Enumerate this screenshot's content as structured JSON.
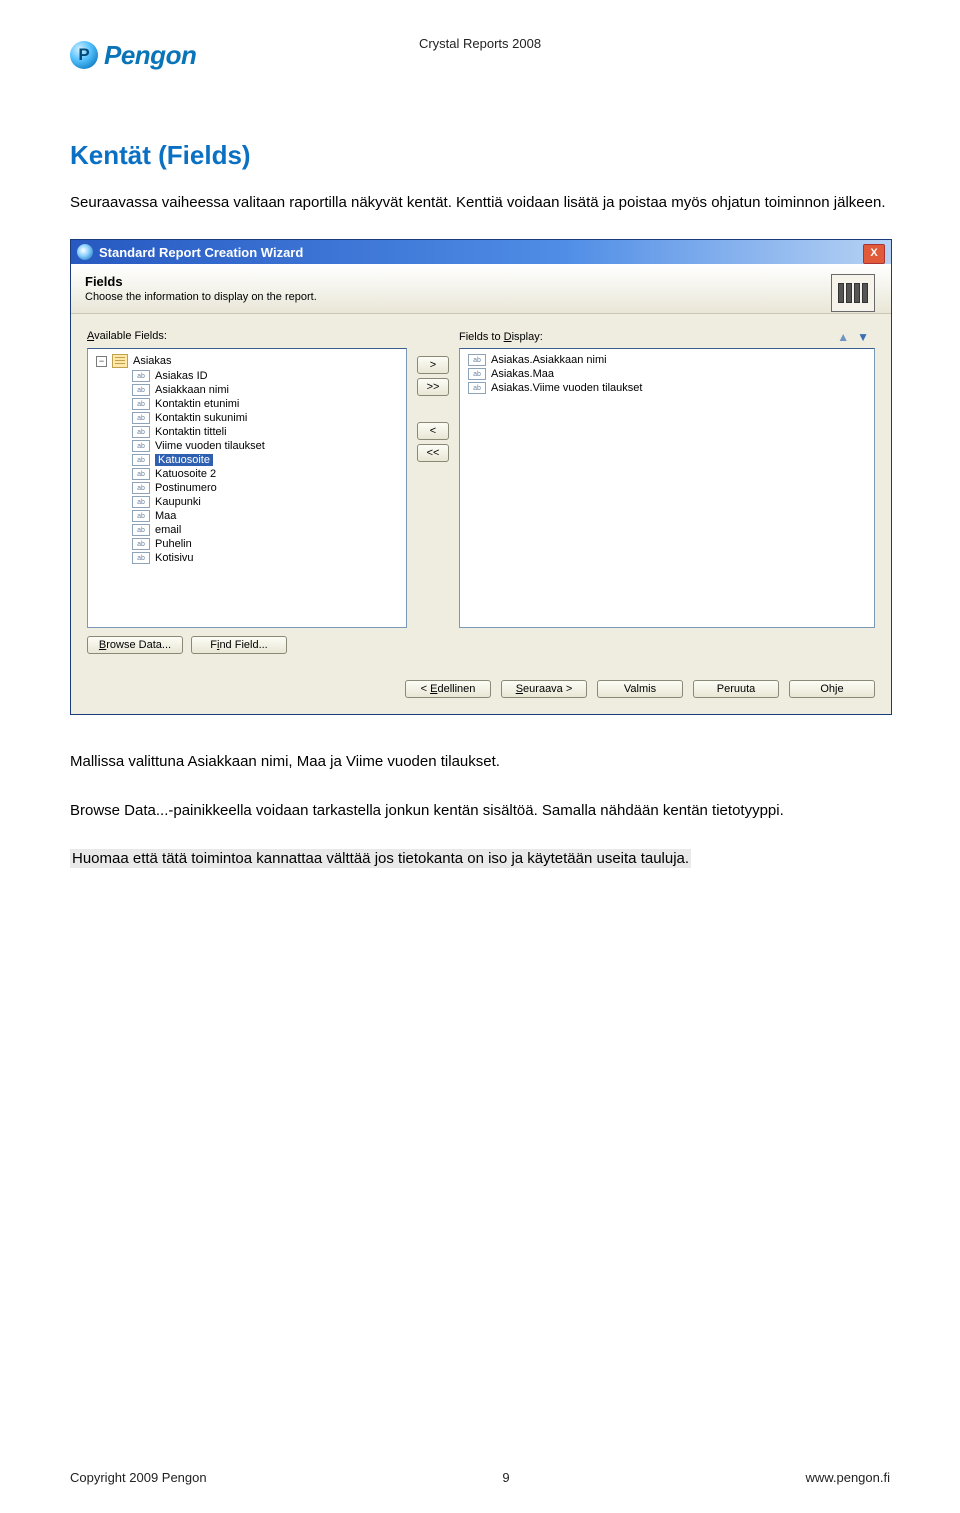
{
  "header": {
    "logo_letter": "P",
    "logo_text": "Pengon",
    "doc_title": "Crystal Reports 2008"
  },
  "section": {
    "title": "Kentät (Fields)",
    "p1": "Seuraavassa vaiheessa valitaan raportilla näkyvät kentät. Kenttiä voidaan lisätä ja poistaa myös ohjatun toiminnon jälkeen.",
    "p2_a": "Mallissa valittuna Asiakkaan nimi, Maa ja Viime vuoden tilaukset.",
    "p3_a": "Browse Data...-painikkeella voidaan tarkastella jonkun kentän sisältöä. Samalla nähdään kentän tietotyyppi.",
    "p4_hl": "Huomaa että tätä toimintoa kannattaa välttää jos tietokanta on iso ja käytetään useita tauluja."
  },
  "wizard": {
    "title": "Standard Report Creation Wizard",
    "head_title": "Fields",
    "head_sub": "Choose the information to display on the report.",
    "avail_label": "Available Fields:",
    "display_label": "Fields to Display:",
    "table_name": "Asiakas",
    "avail_fields": [
      "Asiakas ID",
      "Asiakkaan nimi",
      "Kontaktin etunimi",
      "Kontaktin sukunimi",
      "Kontaktin titteli",
      "Viime vuoden tilaukset",
      "Katuosoite",
      "Katuosoite 2",
      "Postinumero",
      "Kaupunki",
      "Maa",
      "email",
      "Puhelin",
      "Kotisivu"
    ],
    "selected_field": "Katuosoite",
    "display_fields": [
      "Asiakas.Asiakkaan nimi",
      "Asiakas.Maa",
      "Asiakas.Viime vuoden tilaukset"
    ],
    "move_btns": {
      "add": ">",
      "add_all": ">>",
      "rem": "<",
      "rem_all": "<<"
    },
    "browse": "Browse Data...",
    "find": "Find Field...",
    "footer": {
      "back": "< Edellinen",
      "next": "Seuraava >",
      "finish": "Valmis",
      "cancel": "Peruuta",
      "help": "Ohje"
    }
  },
  "footer": {
    "copyright": "Copyright 2009 Pengon",
    "page": "9",
    "url": "www.pengon.fi"
  }
}
